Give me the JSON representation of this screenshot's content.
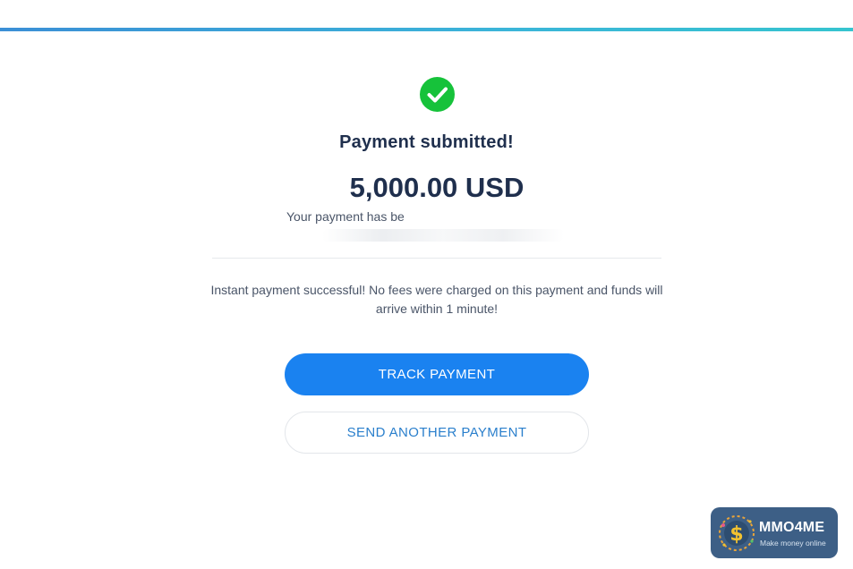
{
  "status": {
    "icon": "check-circle-icon",
    "title": "Payment submitted!",
    "amount": "5,000.00 USD",
    "partial_message": "Your payment has been"
  },
  "info": {
    "message": "Instant payment successful! No fees were charged on this payment and funds will arrive within 1 minute!"
  },
  "actions": {
    "track_label": "TRACK PAYMENT",
    "send_another_label": "SEND ANOTHER PAYMENT"
  },
  "watermark": {
    "name": "MMO4ME",
    "tagline": "Make money online"
  },
  "colors": {
    "accent": "#1a82f0",
    "success": "#16c23a",
    "heading": "#1f2f4d",
    "badge": "#3d5f86"
  }
}
